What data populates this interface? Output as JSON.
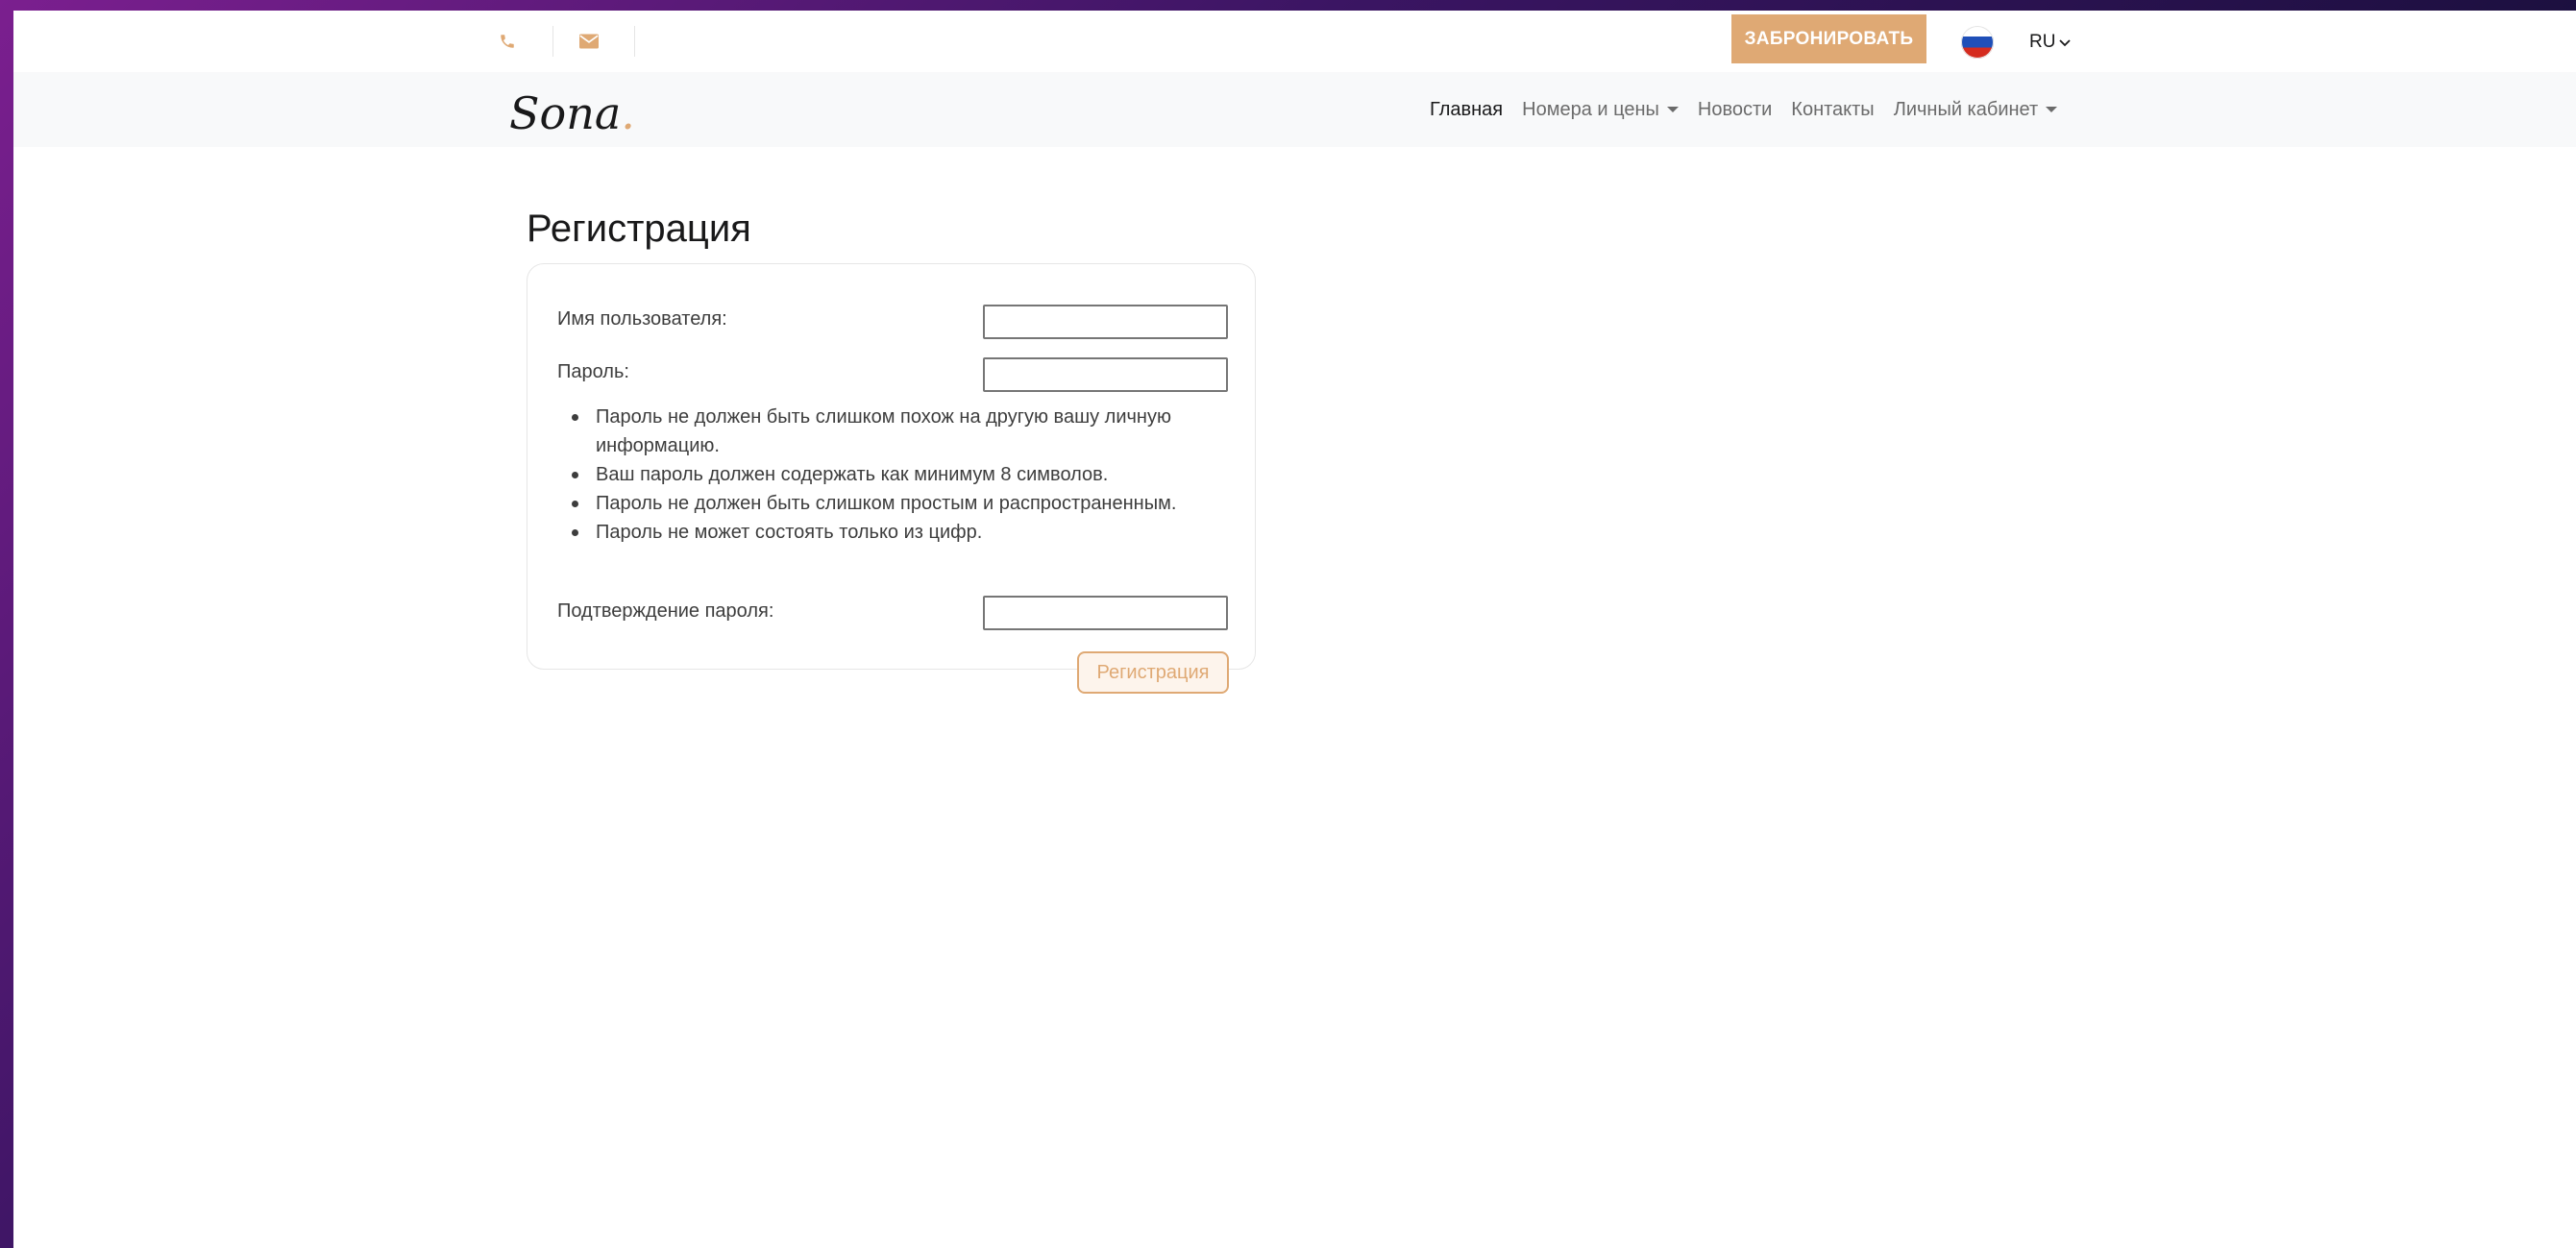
{
  "topbar": {
    "phone_icon": "phone-icon",
    "mail_icon": "mail-icon",
    "book_label": "ЗАБРОНИРОВАТЬ",
    "flag_icon": "russia-flag-icon",
    "lang_label": "RU",
    "accent_color": "#dfa974"
  },
  "navbar": {
    "logo_text": "Sona",
    "logo_dot": ".",
    "items": [
      {
        "label": "Главная",
        "active": true
      },
      {
        "label": "Номера и цены",
        "dropdown": true
      },
      {
        "label": "Новости"
      },
      {
        "label": "Контакты"
      },
      {
        "label": "Личный кабинет",
        "dropdown": true
      }
    ]
  },
  "form": {
    "title": "Регистрация",
    "username_label": "Имя пользователя:",
    "username_value": "",
    "password_label": "Пароль:",
    "password_value": "",
    "rules": [
      "Пароль не должен быть слишком похож на другую вашу личную информацию.",
      "Ваш пароль должен содержать как минимум 8 символов.",
      "Пароль не должен быть слишком простым и распространенным.",
      "Пароль не может состоять только из цифр."
    ],
    "confirm_label": "Подтверждение пароля:",
    "confirm_value": "",
    "submit_label": "Регистрация"
  }
}
